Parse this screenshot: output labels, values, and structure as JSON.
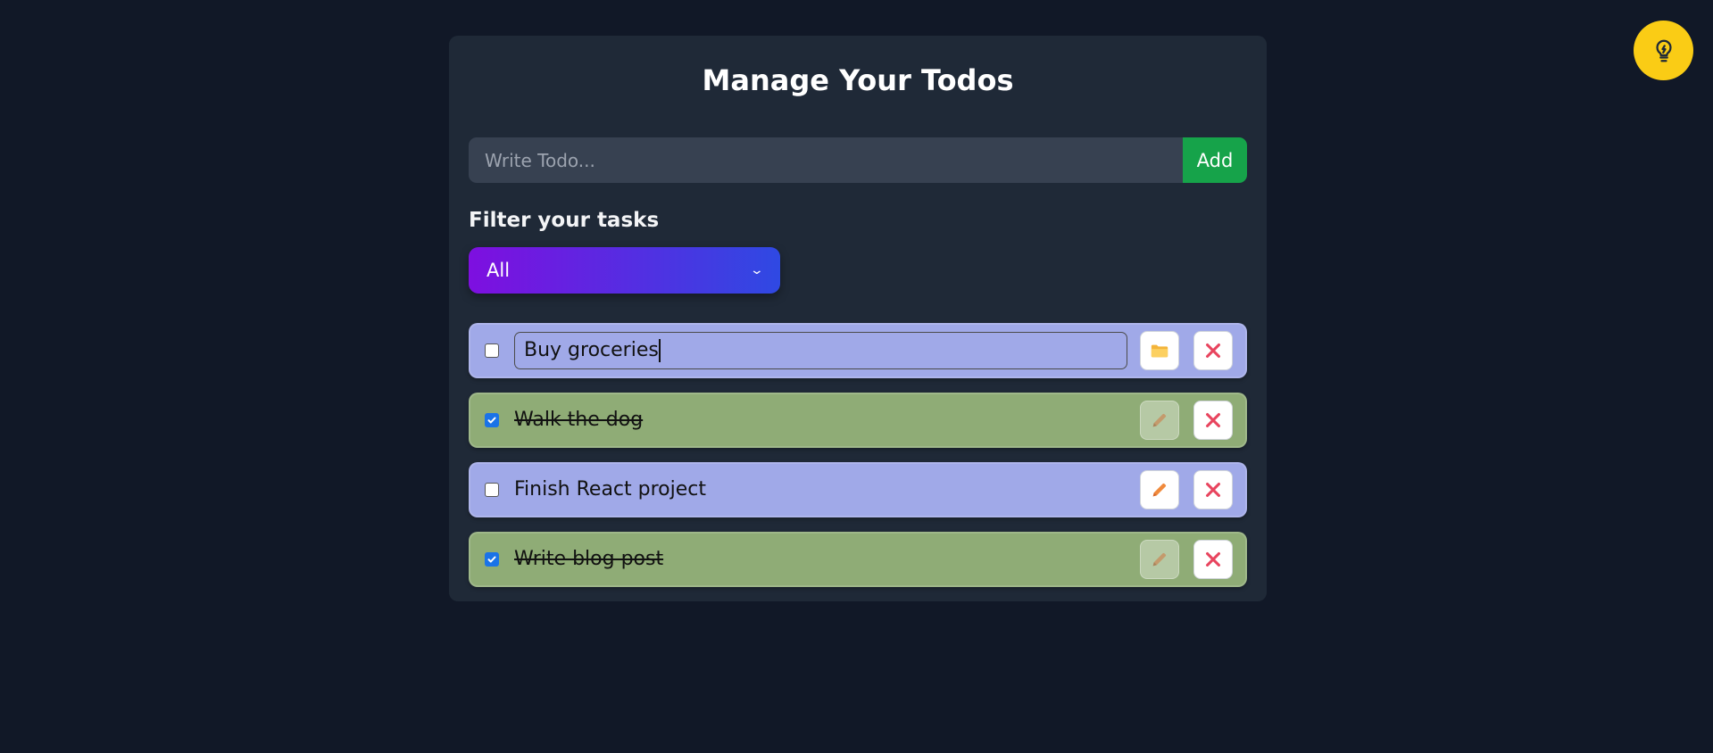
{
  "header": {
    "title": "Manage Your Todos"
  },
  "add_form": {
    "placeholder": "Write Todo...",
    "add_label": "Add"
  },
  "filter": {
    "label": "Filter your tasks",
    "selected": "All"
  },
  "todos": [
    {
      "text": "Buy groceries",
      "completed": false,
      "editing": true,
      "action_icon": "folder-icon"
    },
    {
      "text": "Walk the dog",
      "completed": true,
      "editing": false,
      "action_icon": "pencil-icon"
    },
    {
      "text": "Finish React project",
      "completed": false,
      "editing": false,
      "action_icon": "pencil-icon"
    },
    {
      "text": "Write blog post",
      "completed": true,
      "editing": false,
      "action_icon": "pencil-icon"
    }
  ],
  "theme_toggle": {
    "icon": "lightbulb-icon"
  },
  "colors": {
    "background": "#111827",
    "card": "#1f2937",
    "pending_item": "#a0a9e8",
    "completed_item": "#8fac76",
    "add_button": "#16a34a",
    "delete_icon": "#e8445e",
    "toggle": "#facc15"
  }
}
